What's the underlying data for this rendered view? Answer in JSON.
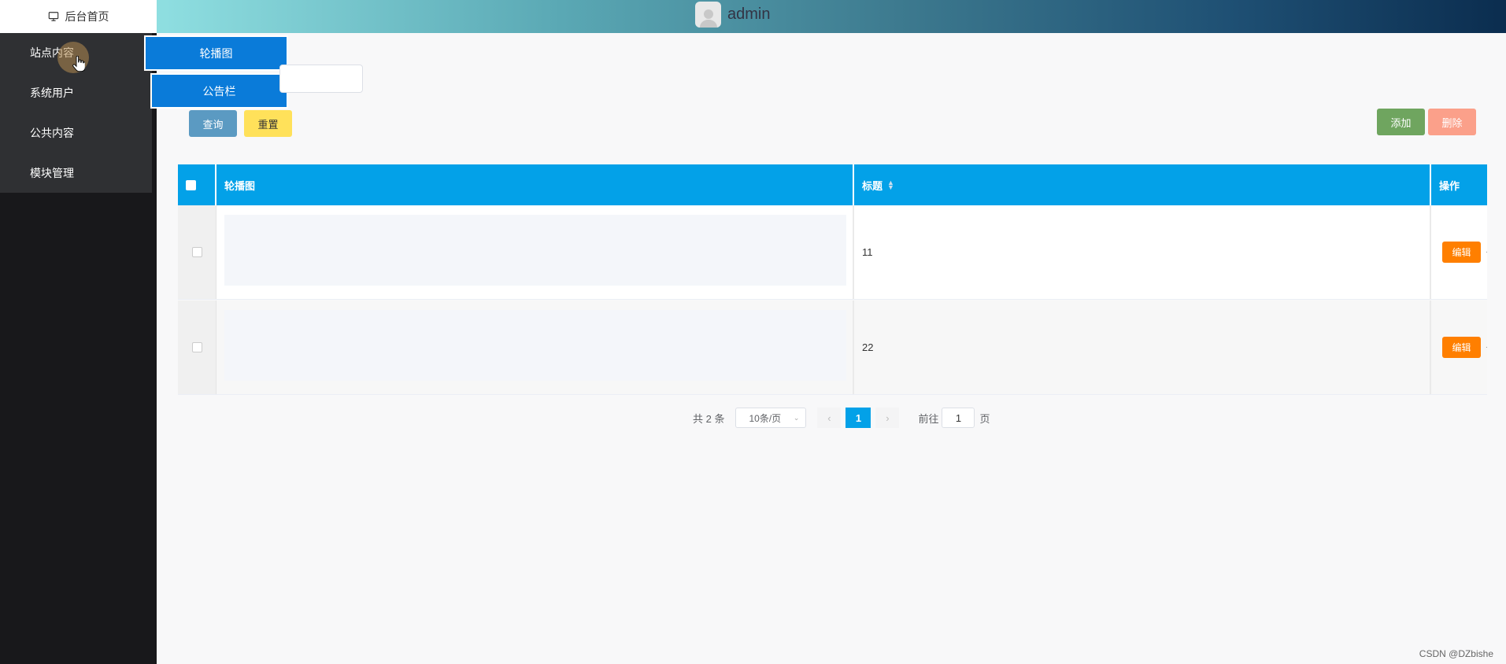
{
  "sidebar": {
    "home_label": "后台首页",
    "items": [
      {
        "label": "站点内容"
      },
      {
        "label": "系统用户"
      },
      {
        "label": "公共内容"
      },
      {
        "label": "模块管理"
      }
    ],
    "flyout": [
      {
        "label": "轮播图"
      },
      {
        "label": "公告栏"
      }
    ]
  },
  "header": {
    "username": "admin"
  },
  "toolbar": {
    "query_label": "查询",
    "reset_label": "重置",
    "add_label": "添加",
    "delete_label": "删除"
  },
  "table": {
    "columns": [
      "轮播图",
      "标题",
      "操作"
    ],
    "rows": [
      {
        "title": "11",
        "edit_label": "编辑"
      },
      {
        "title": "22",
        "edit_label": "编辑"
      }
    ]
  },
  "pagination": {
    "total_text": "共 2 条",
    "page_size": "10条/页",
    "current_page": "1",
    "goto_label": "前往",
    "goto_value": "1",
    "page_suffix": "页"
  },
  "watermark": "CSDN @DZbishe",
  "colors": {
    "header_blue": "#03a1e8",
    "flyout_blue": "#0a7bd9",
    "edit_orange": "#ff7f00",
    "add_green": "#6fa55f",
    "delete_salmon": "#fba08a",
    "reset_yellow": "#ffe15a",
    "query_blue": "#5b9ac2"
  }
}
